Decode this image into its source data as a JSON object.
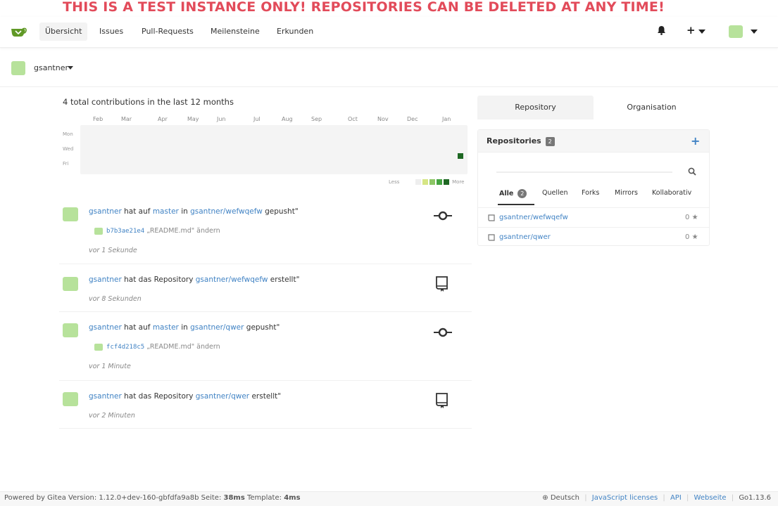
{
  "banner": {
    "text": "THIS IS A TEST INSTANCE ONLY! REPOSITORIES CAN BE DELETED AT ANY TIME!"
  },
  "nav": {
    "items": [
      {
        "label": "Übersicht",
        "active": true
      },
      {
        "label": "Issues"
      },
      {
        "label": "Pull-Requests"
      },
      {
        "label": "Meilensteine"
      },
      {
        "label": "Erkunden"
      }
    ],
    "plus_label": "+"
  },
  "context": {
    "user": "gsantner"
  },
  "contributions": {
    "title": "4 total contributions in the last 12 months",
    "months": [
      "Feb",
      "Mar",
      "Apr",
      "May",
      "Jun",
      "Jul",
      "Aug",
      "Sep",
      "Oct",
      "Nov",
      "Dec",
      "Jan"
    ],
    "days": [
      "Mon",
      "Wed",
      "Fri"
    ],
    "legend_less": "Less",
    "legend_more": "More",
    "legend_colors": [
      "#d6e685",
      "#8cc665",
      "#44a340",
      "#1e6823"
    ]
  },
  "feed": [
    {
      "user": "gsantner",
      "pre": "hat auf",
      "branch": "master",
      "mid": "in",
      "repo": "gsantner/wefwqefw",
      "post": "gepusht\"",
      "sha": "b7b3ae21e4",
      "msg": "„README.md\" ändern",
      "time": "vor 1 Sekunde",
      "icon": "commit-icon"
    },
    {
      "user": "gsantner",
      "pre": "hat das Repository",
      "repo": "gsantner/wefwqefw",
      "post": "erstellt\"",
      "time": "vor 8 Sekunden",
      "icon": "repo-book-icon"
    },
    {
      "user": "gsantner",
      "pre": "hat auf",
      "branch": "master",
      "mid": "in",
      "repo": "gsantner/qwer",
      "post": "gepusht\"",
      "sha": "fcf4d218c5",
      "msg": "„README.md\" ändern",
      "time": "vor 1 Minute",
      "icon": "commit-icon"
    },
    {
      "user": "gsantner",
      "pre": "hat das Repository",
      "repo": "gsantner/qwer",
      "post": "erstellt\"",
      "time": "vor 2 Minuten",
      "icon": "repo-book-icon"
    }
  ],
  "sidebar": {
    "tabs": [
      {
        "label": "Repository",
        "active": true
      },
      {
        "label": "Organisation"
      }
    ],
    "repos_title": "Repositories",
    "repos_count": "2",
    "search_placeholder": "",
    "filters": [
      {
        "label": "Alle",
        "count": "2",
        "active": true
      },
      {
        "label": "Quellen"
      },
      {
        "label": "Forks"
      },
      {
        "label": "Mirrors"
      },
      {
        "label": "Kollaborativ"
      }
    ],
    "repos": [
      {
        "name": "gsantner/wefwqefw",
        "stars": "0"
      },
      {
        "name": "gsantner/qwer",
        "stars": "0"
      }
    ]
  },
  "footer": {
    "powered": "Powered by Gitea Version: 1.12.0+dev-160-gbfdfa9a8b Seite:",
    "page_time": "38ms",
    "template_label": "Template:",
    "template_time": "4ms",
    "language": "Deutsch",
    "links": [
      "JavaScript licenses",
      "API",
      "Webseite"
    ],
    "go_version": "Go1.13.6"
  },
  "colors": {
    "accent": "#4183c4",
    "banner": "#e24b5a",
    "avatar": "#b7e29b",
    "logo": "#609926"
  }
}
